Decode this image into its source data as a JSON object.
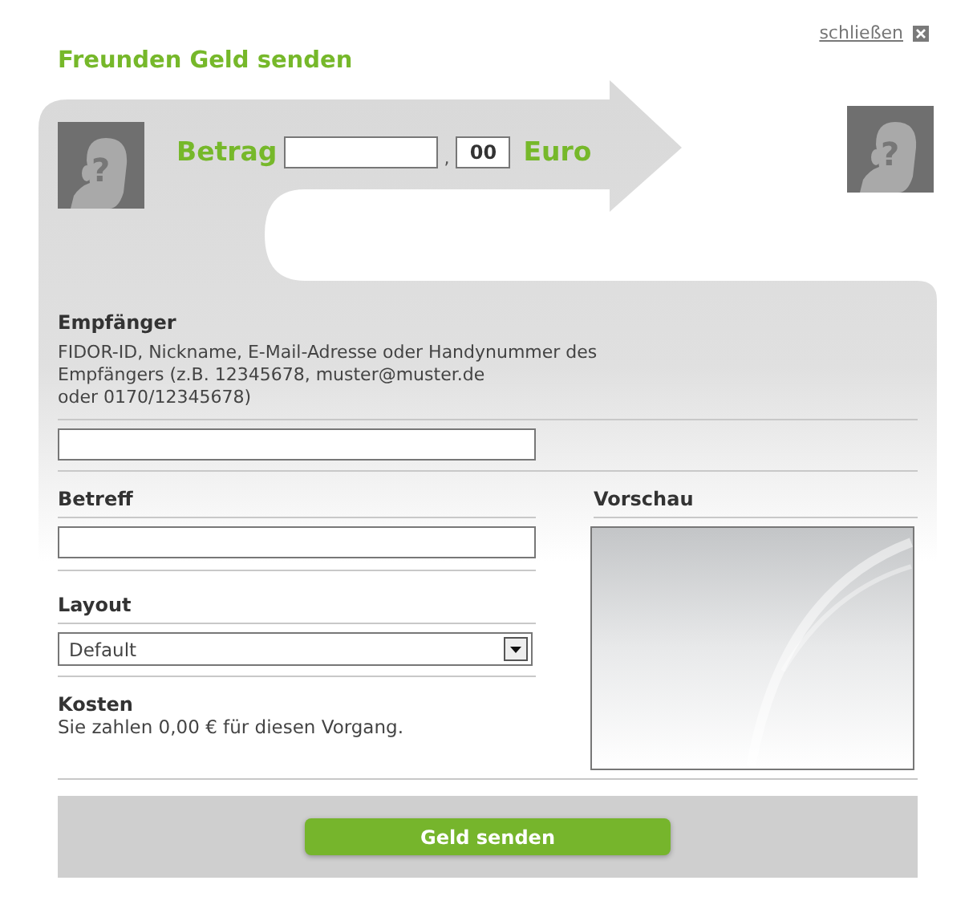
{
  "close_link": "schließen",
  "title": "Freunden Geld senden",
  "sender_avatar": {
    "mark": "?"
  },
  "amount": {
    "label": "Betrag",
    "separator": ",",
    "cents_value": "00",
    "currency": "Euro"
  },
  "recipient_avatar": {
    "mark": "?"
  },
  "recipient": {
    "label": "Empfänger",
    "hint_lines": [
      "FIDOR-ID, Nickname, E-Mail-Adresse oder Handynummer des",
      "Empfängers (z.B. 12345678, muster@muster.de",
      "oder 0170/12345678)"
    ]
  },
  "subject": {
    "label": "Betreff"
  },
  "layout": {
    "label": "Layout",
    "value": "Default"
  },
  "costs": {
    "label": "Kosten",
    "text": "Sie zahlen 0,00 € für diesen Vorgang."
  },
  "preview": {
    "label": "Vorschau"
  },
  "submit_button": "Geld senden"
}
